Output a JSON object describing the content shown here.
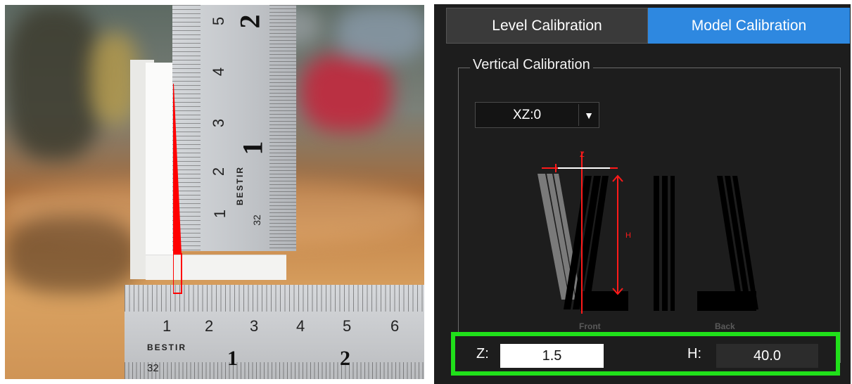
{
  "photo": {
    "vertical_ruler": {
      "numbers": [
        "5",
        "4",
        "3",
        "2",
        "1"
      ],
      "big_numbers": [
        "2",
        "1"
      ],
      "brand": "BESTIR",
      "code": "32"
    },
    "horizontal_ruler": {
      "numbers": [
        "1",
        "2",
        "3",
        "4",
        "5",
        "6"
      ],
      "big_numbers": [
        "1",
        "2"
      ],
      "brand": "BESTIR",
      "code": "32"
    },
    "highlight_color": "#ff0000"
  },
  "tabs": [
    {
      "label": "Level Calibration",
      "active": false
    },
    {
      "label": "Model Calibration",
      "active": true
    }
  ],
  "vertical_calibration": {
    "title": "Vertical Calibration",
    "select": {
      "value": "XZ:0",
      "arrow": "▼"
    },
    "diagram": {
      "dim_z": "Z",
      "dim_h": "H",
      "front_caption": "Front",
      "back_caption": "Back"
    }
  },
  "bottom": {
    "z": {
      "label": "Z:",
      "value": "1.5"
    },
    "h": {
      "label": "H:",
      "value": "40.0"
    },
    "highlight_color": "#20e01a"
  },
  "colors": {
    "accent": "#2e88e0",
    "panel_bg": "#1d1d1d"
  }
}
